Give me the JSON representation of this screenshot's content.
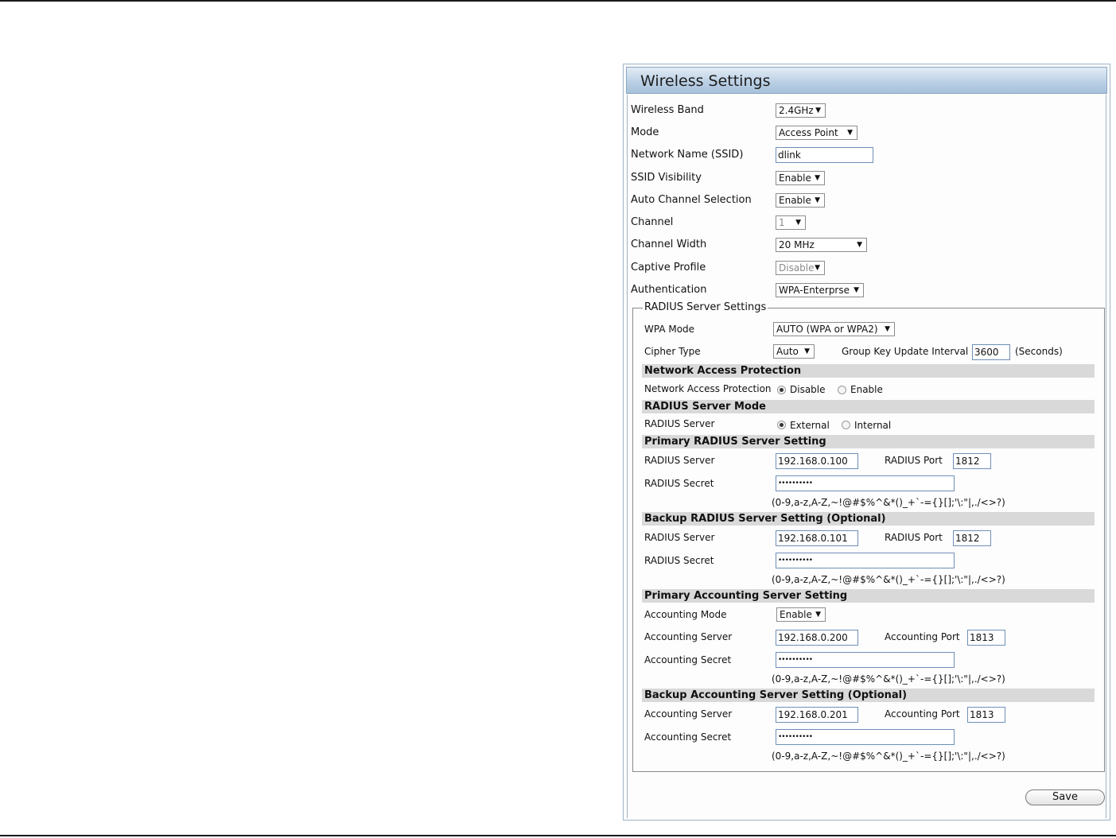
{
  "panel": {
    "title": "Wireless Settings"
  },
  "fields": {
    "wireless_band": {
      "label": "Wireless Band",
      "value": "2.4GHz"
    },
    "mode": {
      "label": "Mode",
      "value": "Access Point"
    },
    "ssid": {
      "label": "Network Name (SSID)",
      "value": "dlink"
    },
    "ssid_visibility": {
      "label": "SSID Visibility",
      "value": "Enable"
    },
    "auto_channel": {
      "label": "Auto Channel Selection",
      "value": "Enable"
    },
    "channel": {
      "label": "Channel",
      "value": "1"
    },
    "channel_width": {
      "label": "Channel Width",
      "value": "20 MHz"
    },
    "captive_profile": {
      "label": "Captive Profile",
      "value": "Disable"
    },
    "authentication": {
      "label": "Authentication",
      "value": "WPA-Enterprse"
    }
  },
  "radius": {
    "legend": "RADIUS Server Settings",
    "wpa_mode": {
      "label": "WPA Mode",
      "value": "AUTO (WPA or WPA2)"
    },
    "cipher_type": {
      "label": "Cipher Type",
      "value": "Auto"
    },
    "group_key": {
      "label": "Group Key Update Interval",
      "value": "3600",
      "unit": "(Seconds)"
    },
    "nap": {
      "header": "Network Access Protection",
      "label": "Network Access Protection",
      "options": [
        "Disable",
        "Enable"
      ],
      "selected": "Disable"
    },
    "server_mode": {
      "header": "RADIUS Server Mode",
      "label": "RADIUS Server",
      "options": [
        "External",
        "Internal"
      ],
      "selected": "External"
    },
    "primary": {
      "header": "Primary RADIUS Server Setting",
      "server_label": "RADIUS Server",
      "server": "192.168.0.100",
      "port_label": "RADIUS Port",
      "port": "1812",
      "secret_label": "RADIUS Secret",
      "secret": "••••••••••",
      "hint": "(0-9,a-z,A-Z,~!@#$%^&*()_+`-={}[];'\\:\"|,./<>?)"
    },
    "backup": {
      "header": "Backup RADIUS Server Setting (Optional)",
      "server_label": "RADIUS Server",
      "server": "192.168.0.101",
      "port_label": "RADIUS Port",
      "port": "1812",
      "secret_label": "RADIUS Secret",
      "secret": "••••••••••",
      "hint": "(0-9,a-z,A-Z,~!@#$%^&*()_+`-={}[];'\\:\"|,./<>?)"
    },
    "primary_acct": {
      "header": "Primary Accounting Server Setting",
      "mode_label": "Accounting Mode",
      "mode": "Enable",
      "server_label": "Accounting Server",
      "server": "192.168.0.200",
      "port_label": "Accounting Port",
      "port": "1813",
      "secret_label": "Accounting Secret",
      "secret": "••••••••••",
      "hint": "(0-9,a-z,A-Z,~!@#$%^&*()_+`-={}[];'\\:\"|,./<>?)"
    },
    "backup_acct": {
      "header": "Backup Accounting Server Setting (Optional)",
      "server_label": "Accounting Server",
      "server": "192.168.0.201",
      "port_label": "Accounting Port",
      "port": "1813",
      "secret_label": "Accounting Secret",
      "secret": "••••••••••",
      "hint": "(0-9,a-z,A-Z,~!@#$%^&*()_+`-={}[];'\\:\"|,./<>?)"
    }
  },
  "save_label": "Save"
}
